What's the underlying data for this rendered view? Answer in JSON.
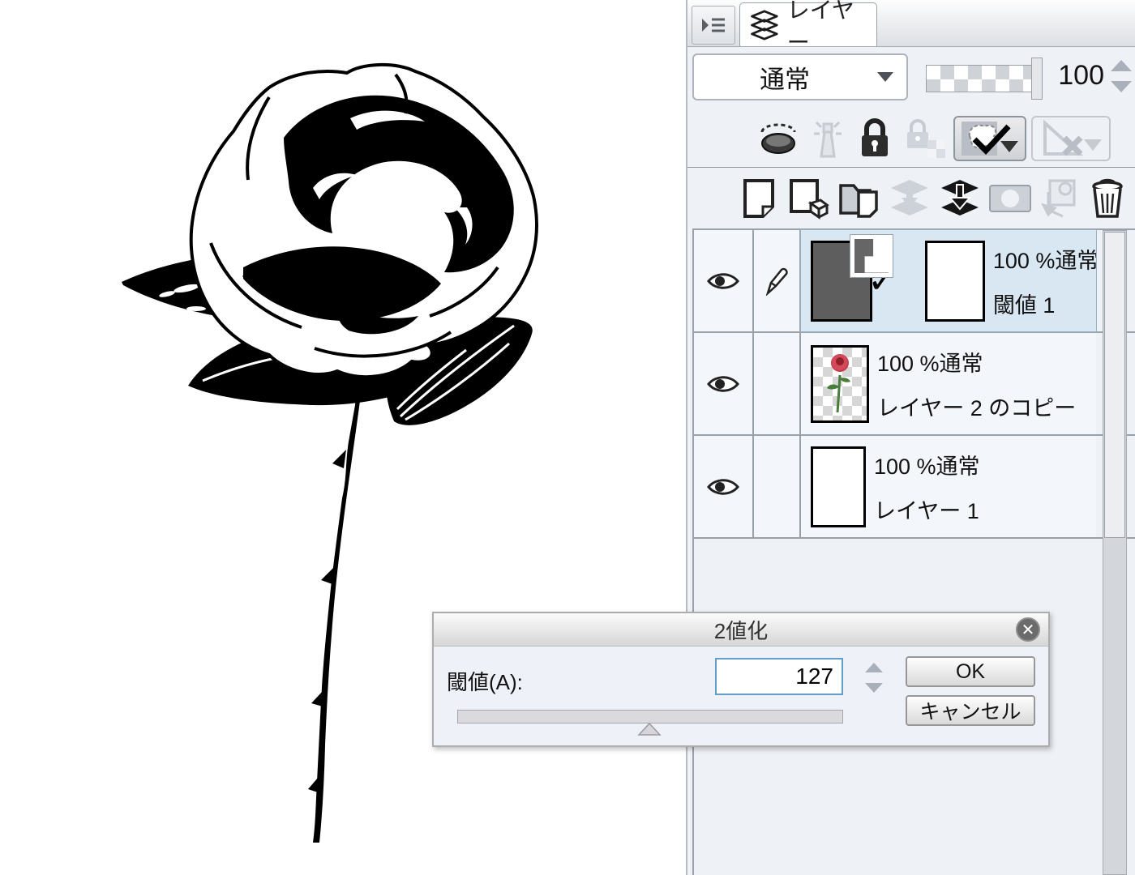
{
  "colors": {
    "panel_bg": "#eef1f6",
    "selected_row": "#d9e7f3",
    "row_bg": "#f3f6fa",
    "focus_border": "#5f9fca",
    "grid_line": "#9aa0a8"
  },
  "canvas": {
    "description": "binarized black-and-white rose artwork on white canvas"
  },
  "layer_panel": {
    "menu_button_icon": "panel-menu-icon",
    "tab": {
      "label": "レイヤー",
      "icon": "layers-icon"
    },
    "blend_mode": {
      "value": "通常"
    },
    "opacity": {
      "value": "100"
    },
    "property_buttons": [
      "clip-at-layer-below",
      "reference-layer",
      "lock-layer",
      "lock-transparent-pixels",
      "enable-mask",
      "ruler-disabled"
    ],
    "action_buttons": [
      "new-raster-layer",
      "new-vector-layer",
      "new-layer-folder",
      "transfer-to-lower-layer",
      "merge-with-lower-layer",
      "create-layer-mask",
      "apply-mask-to-layer",
      "delete-layer"
    ],
    "layers": [
      {
        "opacity_blend": "100 %通常",
        "name": "閾値 1",
        "selected": true,
        "visible": true,
        "editing": true,
        "kind": "binarization-correction-layer"
      },
      {
        "opacity_blend": "100 %通常",
        "name": "レイヤー 2 のコピー",
        "selected": false,
        "visible": true,
        "editing": false,
        "kind": "raster-rose-layer"
      },
      {
        "opacity_blend": "100 %通常",
        "name": "レイヤー 1",
        "selected": false,
        "visible": true,
        "editing": false,
        "kind": "white-paper-layer"
      }
    ]
  },
  "dialog": {
    "title": "2値化",
    "threshold_label": "閾値(A):",
    "threshold_value": "127",
    "slider_percent": 49.8,
    "ok_label": "OK",
    "cancel_label": "キャンセル",
    "close_icon": "close-icon"
  }
}
